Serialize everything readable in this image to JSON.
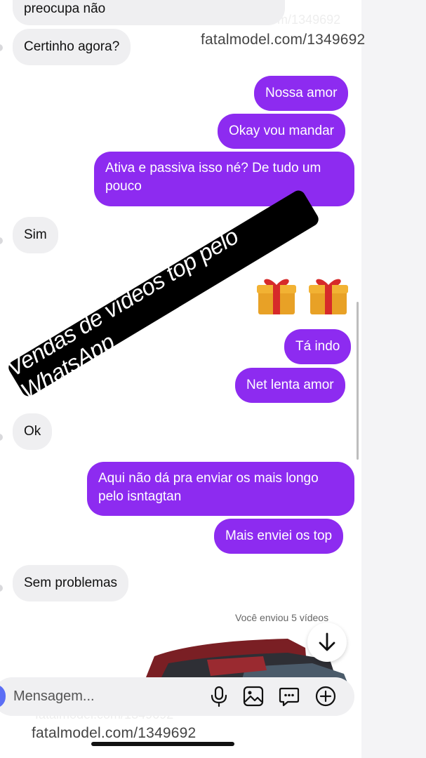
{
  "messages": [
    {
      "text": "preocupa não"
    },
    {
      "text": "Certinho agora?"
    },
    {
      "text": "Nossa amor"
    },
    {
      "text": "Okay vou mandar"
    },
    {
      "text": "Ativa e passiva isso né? De tudo um pouco"
    },
    {
      "text": "Sim"
    },
    {
      "text": "Tá indo"
    },
    {
      "text": "Net lenta amor"
    },
    {
      "text": "Ok"
    },
    {
      "text": "Aqui não dá pra enviar os mais longo pelo isntagtan"
    },
    {
      "text": "Mais enviei os top"
    },
    {
      "text": "Sem problemas"
    }
  ],
  "banner": "Vendas de vídeos top pelo WhatsApp",
  "watermark": "fatalmodel.com/1349692",
  "sent_note": "Você enviou 5 vídeos",
  "composer": {
    "placeholder": "Mensagem..."
  },
  "icons": [
    "gift-emoji-icon",
    "gift-emoji-icon",
    "arrow-down-icon",
    "microphone-icon",
    "image-icon",
    "sticker-chat-icon",
    "plus-circle-icon"
  ],
  "colors": {
    "outgoing": "#8d2bf0",
    "incoming": "#efeff1",
    "banner": "#000000"
  }
}
